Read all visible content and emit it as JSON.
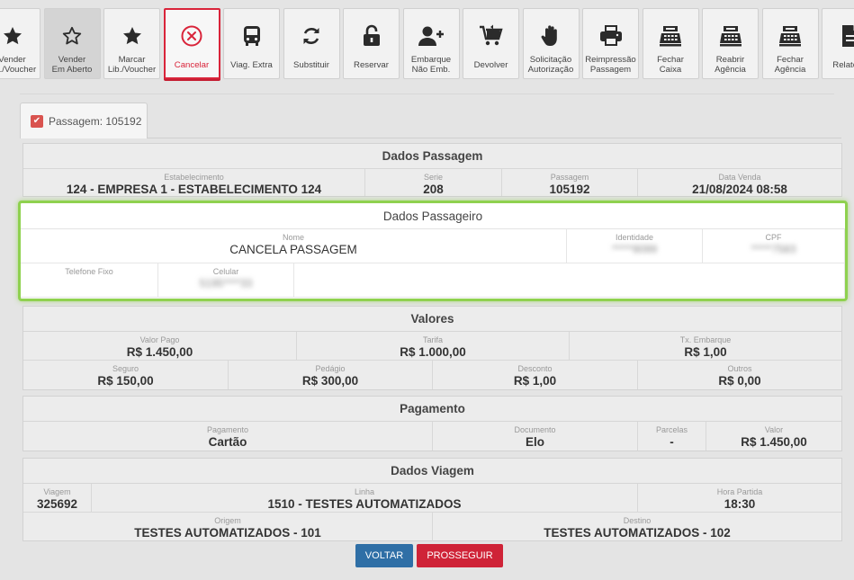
{
  "toolbar": [
    {
      "name": "vender-voucher-button",
      "icon": "star-half-icon",
      "label": "Vender\nLib./Voucher"
    },
    {
      "name": "vender-em-aberto-button",
      "icon": "star-outline-icon",
      "label": "Vender\nEm Aberto",
      "state": "active"
    },
    {
      "name": "marcar-voucher-button",
      "icon": "star-filled-icon",
      "label": "Marcar\nLib./Voucher"
    },
    {
      "name": "cancelar-button",
      "icon": "cancel-circle-icon",
      "label": "Cancelar",
      "state": "selected"
    },
    {
      "name": "viag-extra-button",
      "icon": "bus-icon",
      "label": "Viag. Extra"
    },
    {
      "name": "substituir-button",
      "icon": "refresh-icon",
      "label": "Substituir"
    },
    {
      "name": "reservar-button",
      "icon": "lock-open-icon",
      "label": "Reservar"
    },
    {
      "name": "embarque-nao-emb-button",
      "icon": "user-plus-icon",
      "label": "Embarque\nNão Emb."
    },
    {
      "name": "devolver-button",
      "icon": "cart-return-icon",
      "label": "Devolver"
    },
    {
      "name": "solicitacao-autorizacao-button",
      "icon": "hand-icon",
      "label": "Solicitação\nAutorização"
    },
    {
      "name": "reimpressao-passagem-button",
      "icon": "printer-icon",
      "label": "Reimpressão\nPassagem"
    },
    {
      "name": "fechar-caixa-button",
      "icon": "cash-register-icon",
      "label": "Fechar\nCaixa"
    },
    {
      "name": "reabrir-agencia-button",
      "icon": "cash-register-icon",
      "label": "Reabrir\nAgência"
    },
    {
      "name": "fechar-agencia-button",
      "icon": "cash-register-icon",
      "label": "Fechar\nAgência"
    },
    {
      "name": "relatorio-button",
      "icon": "document-icon",
      "label": "Relatório"
    }
  ],
  "tab": {
    "label": "Passagem: 105192"
  },
  "dados_passagem": {
    "title": "Dados Passagem",
    "estabelecimento_label": "Estabelecimento",
    "estabelecimento": "124 - EMPRESA 1 - ESTABELECIMENTO 124",
    "serie_label": "Serie",
    "serie": "208",
    "passagem_label": "Passagem",
    "passagem": "105192",
    "data_venda_label": "Data Venda",
    "data_venda": "21/08/2024 08:58"
  },
  "dados_passageiro": {
    "title": "Dados Passageiro",
    "nome_label": "Nome",
    "nome": "CANCELA PASSAGEM",
    "identidade_label": "Identidade",
    "identidade": "*****8099",
    "cpf_label": "CPF",
    "cpf": "*****7583",
    "telefone_label": "Telefone Fixo",
    "telefone": "",
    "celular_label": "Celular",
    "celular": "5195****33"
  },
  "valores": {
    "title": "Valores",
    "valor_pago_label": "Valor Pago",
    "valor_pago": "R$ 1.450,00",
    "tarifa_label": "Tarifa",
    "tarifa": "R$ 1.000,00",
    "tx_embarque_label": "Tx. Embarque",
    "tx_embarque": "R$ 1,00",
    "seguro_label": "Seguro",
    "seguro": "R$ 150,00",
    "pedagio_label": "Pedágio",
    "pedagio": "R$ 300,00",
    "desconto_label": "Desconto",
    "desconto": "R$ 1,00",
    "outros_label": "Outros",
    "outros": "R$ 0,00"
  },
  "pagamento": {
    "title": "Pagamento",
    "pagamento_label": "Pagamento",
    "pagamento": "Cartão",
    "documento_label": "Documento",
    "documento": "Elo",
    "parcelas_label": "Parcelas",
    "parcelas": "-",
    "valor_label": "Valor",
    "valor": "R$ 1.450,00"
  },
  "dados_viagem": {
    "title": "Dados Viagem",
    "viagem_label": "Viagem",
    "viagem": "325692",
    "linha_label": "Linha",
    "linha": "1510 - TESTES AUTOMATIZADOS",
    "hora_partida_label": "Hora Partida",
    "hora_partida": "18:30",
    "origem_label": "Origem",
    "origem": "TESTES AUTOMATIZADOS - 101",
    "destino_label": "Destino",
    "destino": "TESTES AUTOMATIZADOS - 102"
  },
  "actions": {
    "voltar": "VOLTAR",
    "prosseguir": "PROSSEGUIR"
  },
  "colors": {
    "selected_border": "#d9243a",
    "highlight": "#8fd14f",
    "voltar": "#2f6fa6",
    "prosseguir": "#cf2337"
  }
}
